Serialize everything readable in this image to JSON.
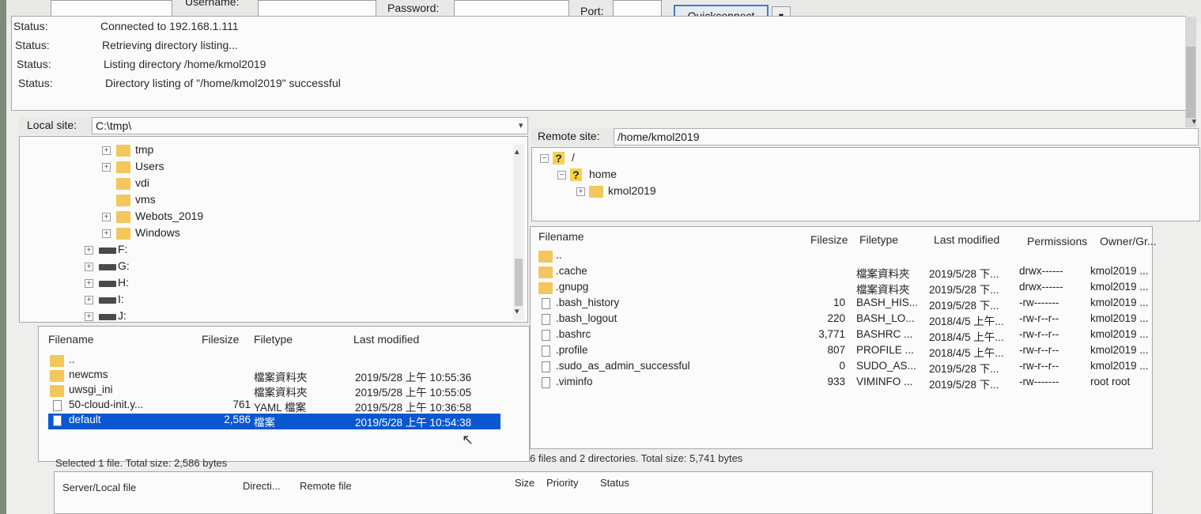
{
  "quickconnect": {
    "username_label": "Username:",
    "password_label": "Password:",
    "port_label": "Port:",
    "button_label": "Quickconnect",
    "dropdown_glyph": "▼"
  },
  "log": [
    {
      "key": "Status:",
      "value": "Connected to 192.168.1.111"
    },
    {
      "key": "Status:",
      "value": "Retrieving directory listing..."
    },
    {
      "key": "Status:",
      "value": "Listing directory /home/kmol2019"
    },
    {
      "key": "Status:",
      "value": "Directory listing of \"/home/kmol2019\" successful"
    }
  ],
  "local": {
    "site_label": "Local site:",
    "site_path": "C:\\tmp\\",
    "tree": [
      {
        "label": "tmp",
        "kind": "folder",
        "expander": "+"
      },
      {
        "label": "Users",
        "kind": "folder",
        "expander": "+"
      },
      {
        "label": "vdi",
        "kind": "folder",
        "expander": ""
      },
      {
        "label": "vms",
        "kind": "folder",
        "expander": ""
      },
      {
        "label": "Webots_2019",
        "kind": "folder",
        "expander": "+"
      },
      {
        "label": "Windows",
        "kind": "folder",
        "expander": "+"
      },
      {
        "label": "F:",
        "kind": "drive",
        "expander": "+"
      },
      {
        "label": "G:",
        "kind": "drive",
        "expander": "+"
      },
      {
        "label": "H:",
        "kind": "drive",
        "expander": "+"
      },
      {
        "label": "I:",
        "kind": "drive",
        "expander": "+"
      },
      {
        "label": "J:",
        "kind": "drive",
        "expander": "+"
      }
    ],
    "columns": {
      "filename": "Filename",
      "filesize": "Filesize",
      "filetype": "Filetype",
      "modified": "Last modified"
    },
    "files": [
      {
        "name": "..",
        "size": "",
        "type": "",
        "modified": "",
        "kind": "folder",
        "selected": false
      },
      {
        "name": "newcms",
        "size": "",
        "type": "檔案資料夾",
        "modified": "2019/5/28 上午 10:55:36",
        "kind": "folder",
        "selected": false
      },
      {
        "name": "uwsgi_ini",
        "size": "",
        "type": "檔案資料夾",
        "modified": "2019/5/28 上午 10:55:05",
        "kind": "folder",
        "selected": false
      },
      {
        "name": "50-cloud-init.y...",
        "size": "761",
        "type": "YAML 檔案",
        "modified": "2019/5/28 上午 10:36:58",
        "kind": "file",
        "selected": false
      },
      {
        "name": "default",
        "size": "2,586",
        "type": "檔案",
        "modified": "2019/5/28 上午 10:54:38",
        "kind": "file",
        "selected": true
      }
    ],
    "status": "Selected 1 file. Total size: 2,586 bytes"
  },
  "remote": {
    "site_label": "Remote site:",
    "site_path": "/home/kmol2019",
    "tree": [
      {
        "label": "/",
        "expander": "−",
        "kind": "question"
      },
      {
        "label": "home",
        "expander": "−",
        "kind": "question"
      },
      {
        "label": "kmol2019",
        "expander": "+",
        "kind": "folder"
      }
    ],
    "columns": {
      "filename": "Filename",
      "filesize": "Filesize",
      "filetype": "Filetype",
      "modified": "Last modified",
      "permissions": "Permissions",
      "owner": "Owner/Gr..."
    },
    "files": [
      {
        "name": "..",
        "size": "",
        "type": "",
        "modified": "",
        "perm": "",
        "owner": "",
        "kind": "folder"
      },
      {
        "name": ".cache",
        "size": "",
        "type": "檔案資料夾",
        "modified": "2019/5/28 下...",
        "perm": "drwx------",
        "owner": "kmol2019 ...",
        "kind": "folder"
      },
      {
        "name": ".gnupg",
        "size": "",
        "type": "檔案資料夾",
        "modified": "2019/5/28 下...",
        "perm": "drwx------",
        "owner": "kmol2019 ...",
        "kind": "folder"
      },
      {
        "name": ".bash_history",
        "size": "10",
        "type": "BASH_HIS...",
        "modified": "2019/5/28 下...",
        "perm": "-rw-------",
        "owner": "kmol2019 ...",
        "kind": "file"
      },
      {
        "name": ".bash_logout",
        "size": "220",
        "type": "BASH_LO...",
        "modified": "2018/4/5 上午...",
        "perm": "-rw-r--r--",
        "owner": "kmol2019 ...",
        "kind": "file"
      },
      {
        "name": ".bashrc",
        "size": "3,771",
        "type": "BASHRC ...",
        "modified": "2018/4/5 上午...",
        "perm": "-rw-r--r--",
        "owner": "kmol2019 ...",
        "kind": "file"
      },
      {
        "name": ".profile",
        "size": "807",
        "type": "PROFILE ...",
        "modified": "2018/4/5 上午...",
        "perm": "-rw-r--r--",
        "owner": "kmol2019 ...",
        "kind": "file"
      },
      {
        "name": ".sudo_as_admin_successful",
        "size": "0",
        "type": "SUDO_AS...",
        "modified": "2019/5/28 下...",
        "perm": "-rw-r--r--",
        "owner": "kmol2019 ...",
        "kind": "file"
      },
      {
        "name": ".viminfo",
        "size": "933",
        "type": "VIMINFO ...",
        "modified": "2019/5/28 下...",
        "perm": "-rw-------",
        "owner": "root root",
        "kind": "file"
      }
    ],
    "status": "6 files and 2 directories. Total size: 5,741 bytes"
  },
  "queue": {
    "columns": {
      "server_local": "Server/Local file",
      "direction": "Directi...",
      "remote": "Remote file",
      "size": "Size",
      "priority": "Priority",
      "status": "Status"
    }
  },
  "colors": {
    "selection": "#0a57d1",
    "folder": "#f2c75c",
    "button_border": "#3d7bd0"
  }
}
